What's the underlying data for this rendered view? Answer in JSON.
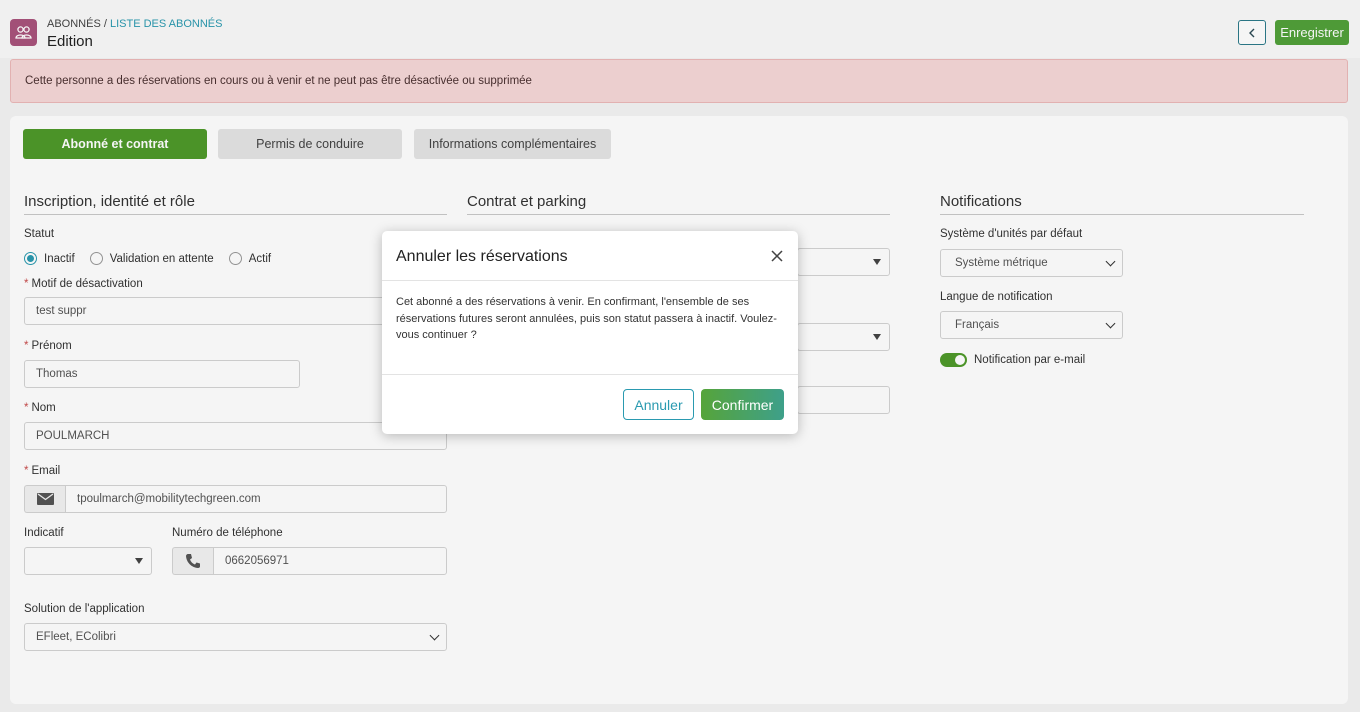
{
  "header": {
    "breadcrumb_root": "ABONNÉS",
    "breadcrumb_separator": " / ",
    "breadcrumb_link": "LISTE DES ABONNÉS",
    "title": "Edition",
    "save_label": "Enregistrer",
    "back_icon": "chevron-left-icon",
    "app_icon": "users-icon"
  },
  "alert": {
    "text": "Cette personne a des réservations en cours ou à venir et ne peut pas être désactivée ou supprimée"
  },
  "tabs": [
    {
      "label": "Abonné et contrat",
      "active": true
    },
    {
      "label": "Permis de conduire",
      "active": false
    },
    {
      "label": "Informations complémentaires",
      "active": false
    }
  ],
  "identity": {
    "section_title": "Inscription, identité et rôle",
    "status_label": "Statut",
    "status_options": [
      "Inactif",
      "Validation en attente",
      "Actif"
    ],
    "status_selected": "Inactif",
    "reason_label": "Motif de désactivation",
    "reason_value": "test suppr",
    "firstname_label": "Prénom",
    "firstname_value": "Thomas",
    "lastname_label": "Nom",
    "lastname_value": "POULMARCH",
    "email_label": "Email",
    "email_value": "tpoulmarch@mobilitytechgreen.com",
    "prefix_label": "Indicatif",
    "prefix_value": "",
    "phone_label": "Numéro de téléphone",
    "phone_value": "0662056971",
    "app_label": "Solution de l'application",
    "app_value": "EFleet, EColibri"
  },
  "contract": {
    "section_title": "Contrat et parking"
  },
  "notifications": {
    "section_title": "Notifications",
    "units_label": "Système d'unités par défaut",
    "units_value": "Système métrique",
    "language_label": "Langue de notification",
    "language_value": "Français",
    "email_toggle_label": "Notification par e-mail",
    "email_toggle_on": true
  },
  "modal": {
    "title": "Annuler les réservations",
    "body": "Cet abonné a des réservations à venir. En confirmant, l'ensemble de ses réservations futures seront annulées, puis son statut passera à inactif. Voulez-vous continuer ?",
    "cancel_label": "Annuler",
    "confirm_label": "Confirmer"
  },
  "colors": {
    "primary_green": "#4f9a2a",
    "accent_teal": "#2a9ab0",
    "alert_bg": "#f6d8d8"
  }
}
